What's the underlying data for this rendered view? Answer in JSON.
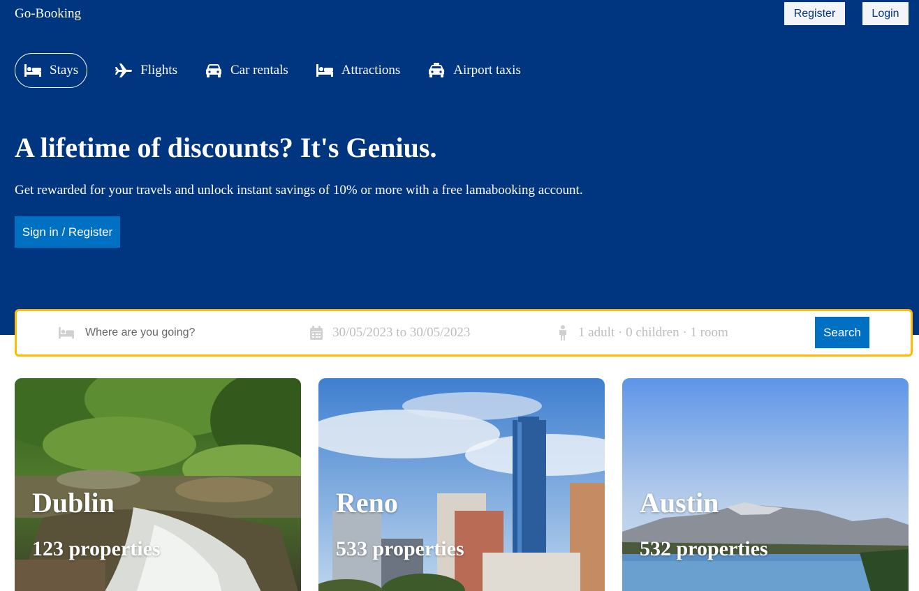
{
  "header": {
    "logo": "Go-Booking",
    "register_label": "Register",
    "login_label": "Login",
    "nav": [
      {
        "label": "Stays",
        "icon": "bed-icon",
        "active": true
      },
      {
        "label": "Flights",
        "icon": "plane-icon"
      },
      {
        "label": "Car rentals",
        "icon": "car-icon"
      },
      {
        "label": "Attractions",
        "icon": "bed-icon"
      },
      {
        "label": "Airport taxis",
        "icon": "taxi-icon"
      }
    ],
    "headline": "A lifetime of discounts? It's Genius.",
    "subtext": "Get rewarded for your travels and unlock instant savings of 10% or more with a free lamabooking account.",
    "signin_label": "Sign in / Register"
  },
  "search": {
    "destination_placeholder": "Where are you going?",
    "dates": "30/05/2023 to 30/05/2023",
    "guests": "1 adult · 0 children · 1 room",
    "button_label": "Search"
  },
  "featured": [
    {
      "city": "Dublin",
      "properties": "123 properties"
    },
    {
      "city": "Reno",
      "properties": "533 properties"
    },
    {
      "city": "Austin",
      "properties": "532 properties"
    }
  ],
  "colors": {
    "header_bg": "#003580",
    "primary_button": "#0071c2",
    "search_border": "#febb02"
  }
}
